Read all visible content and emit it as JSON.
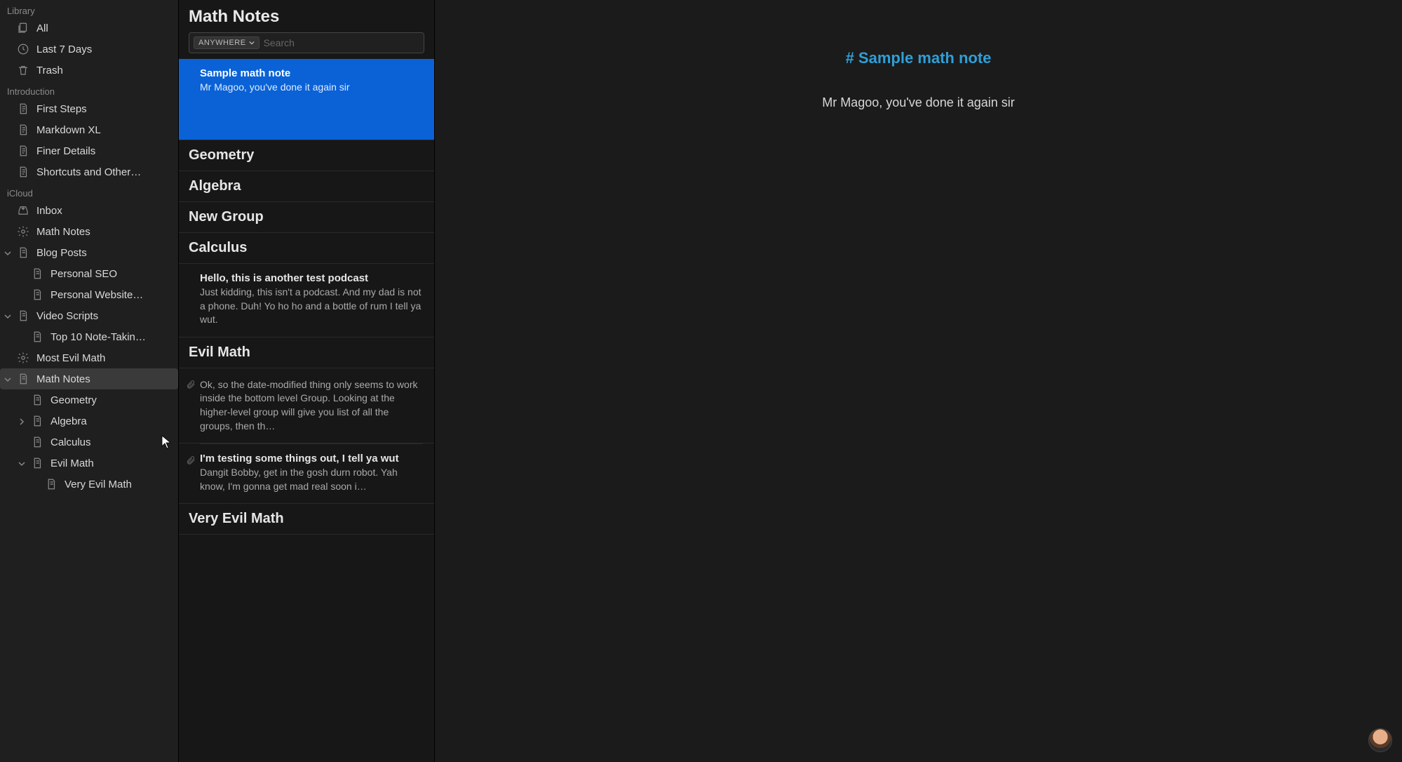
{
  "sidebar": {
    "sections": {
      "library": {
        "title": "Library",
        "items": [
          {
            "icon": "stack",
            "label": "All"
          },
          {
            "icon": "clock",
            "label": "Last 7 Days"
          },
          {
            "icon": "trash",
            "label": "Trash"
          }
        ]
      },
      "introduction": {
        "title": "Introduction",
        "items": [
          {
            "icon": "doc",
            "label": "First Steps"
          },
          {
            "icon": "doc",
            "label": "Markdown XL"
          },
          {
            "icon": "doc",
            "label": "Finer Details"
          },
          {
            "icon": "doc",
            "label": "Shortcuts and Other…"
          }
        ]
      },
      "icloud": {
        "title": "iCloud",
        "items": [
          {
            "icon": "inbox",
            "label": "Inbox"
          },
          {
            "icon": "gear",
            "label": "Math Notes"
          },
          {
            "icon": "doc",
            "label": "Blog Posts",
            "disclosure": "down",
            "children": [
              {
                "icon": "doc",
                "label": "Personal SEO"
              },
              {
                "icon": "doc",
                "label": "Personal Website…"
              }
            ]
          },
          {
            "icon": "doc",
            "label": "Video Scripts",
            "disclosure": "down",
            "children": [
              {
                "icon": "doc",
                "label": "Top 10 Note-Takin…"
              }
            ]
          },
          {
            "icon": "gear",
            "label": "Most Evil Math"
          },
          {
            "icon": "doc",
            "label": "Math Notes",
            "disclosure": "down",
            "selected": true,
            "children": [
              {
                "icon": "doc",
                "label": "Geometry"
              },
              {
                "icon": "doc",
                "label": "Algebra",
                "disclosure": "right"
              },
              {
                "icon": "doc",
                "label": "Calculus"
              },
              {
                "icon": "doc",
                "label": "Evil Math",
                "disclosure": "down",
                "children": [
                  {
                    "icon": "doc",
                    "label": "Very Evil Math"
                  }
                ]
              }
            ]
          }
        ]
      }
    }
  },
  "notelist": {
    "title": "Math Notes",
    "search": {
      "scope": "ANYWHERE",
      "placeholder": "Search"
    },
    "entries": [
      {
        "kind": "note",
        "selected": true,
        "title": "Sample math note",
        "preview": "Mr Magoo, you've done it again sir"
      },
      {
        "kind": "group",
        "label": "Geometry"
      },
      {
        "kind": "group",
        "label": "Algebra"
      },
      {
        "kind": "group",
        "label": "New Group"
      },
      {
        "kind": "group",
        "label": "Calculus"
      },
      {
        "kind": "note",
        "title": "Hello, this is another test podcast",
        "preview": "Just kidding, this isn't a podcast. And my dad is not a phone. Duh! Yo ho ho and a bottle of rum I tell ya wut."
      },
      {
        "kind": "group",
        "label": "Evil Math"
      },
      {
        "kind": "note",
        "attachment": true,
        "untitled": true,
        "title": "",
        "preview": "Ok, so the date-modified thing only seems to work inside the bottom level Group. Looking at the higher-level group will give you list of all the groups, then th…"
      },
      {
        "kind": "note",
        "attachment": true,
        "title": "I'm testing some things out, I tell ya wut",
        "preview": "Dangit Bobby, get in the gosh durn robot. Yah know, I'm gonna get mad real soon i…"
      },
      {
        "kind": "group",
        "label": "Very Evil Math"
      }
    ]
  },
  "editor": {
    "heading": "# Sample math note",
    "body": "Mr Magoo, you've done it again sir"
  }
}
